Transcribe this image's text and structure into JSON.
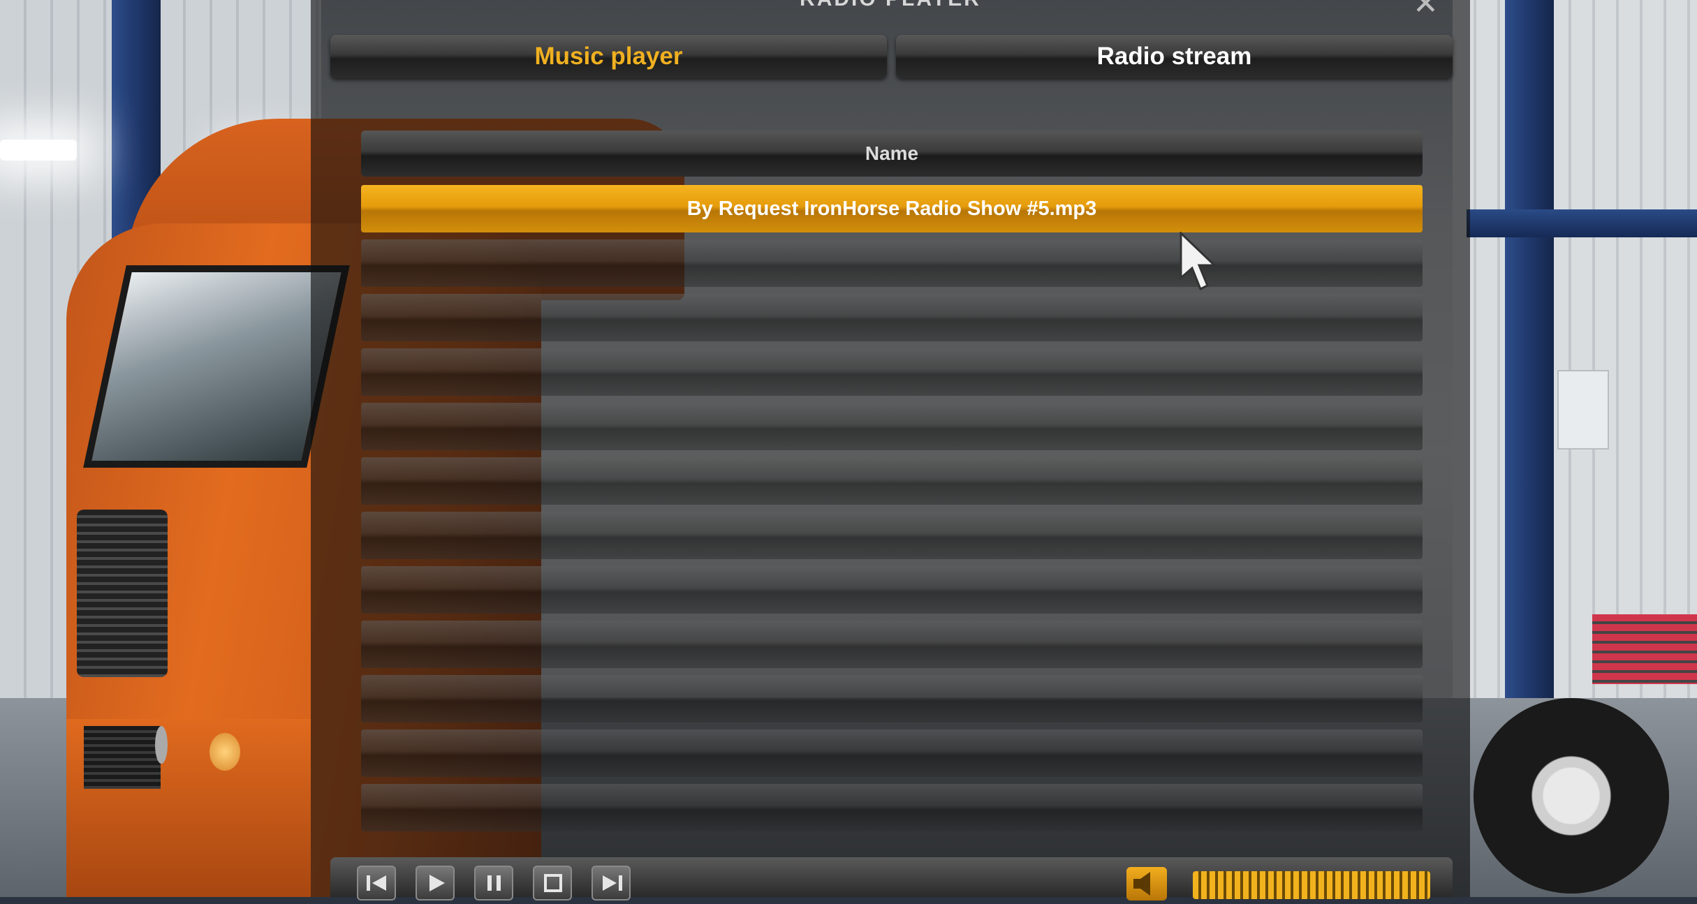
{
  "window": {
    "title": "RADIO PLAYER",
    "close_glyph": "✕"
  },
  "tabs": [
    {
      "label": "Music player",
      "active": true
    },
    {
      "label": "Radio stream",
      "active": false
    }
  ],
  "list": {
    "header": "Name",
    "rows": [
      {
        "name": "By Request IronHorse Radio Show #5.mp3",
        "selected": true
      },
      {
        "name": ""
      },
      {
        "name": ""
      },
      {
        "name": ""
      },
      {
        "name": ""
      },
      {
        "name": ""
      },
      {
        "name": ""
      },
      {
        "name": ""
      },
      {
        "name": ""
      },
      {
        "name": ""
      },
      {
        "name": ""
      },
      {
        "name": ""
      }
    ]
  },
  "controls": {
    "buttons": [
      "previous-icon",
      "play-icon",
      "pause-icon",
      "stop-icon",
      "next-icon"
    ],
    "volume_icon": "speaker-icon",
    "volume_level": 1.0
  },
  "colors": {
    "accent": "#f0b020",
    "selected_row": "#e59c0c",
    "tab_inactive_text": "#ffffff"
  }
}
